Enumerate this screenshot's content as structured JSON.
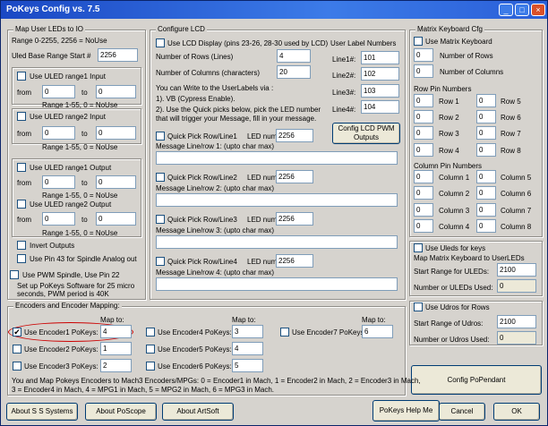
{
  "window": {
    "title": "PoKeys Config vs.  7.5",
    "minimize": "_",
    "maximize": "□",
    "close": "×"
  },
  "uled": {
    "group": "Map User LEDs to IO",
    "range_note": "Range 0-2255, 2256 = NoUse",
    "base_label": "Uled Base Range Start #",
    "base_value": "2256",
    "in1": {
      "label": "Use ULED range1 Input",
      "from_label": "from",
      "to_label": "to",
      "from": "0",
      "to": "0",
      "note": "Range 1-55, 0 = NoUse"
    },
    "in2": {
      "label": "Use ULED range2 Input",
      "from_label": "from",
      "to_label": "to",
      "from": "0",
      "to": "0",
      "note": "Range 1-55, 0 = NoUse"
    },
    "out1": {
      "label": "Use ULED range1 Output",
      "from_label": "from",
      "to_label": "to",
      "from": "0",
      "to": "0",
      "note": "Range 1-55, 0 = NoUse"
    },
    "out2": {
      "label": "Use ULED range2 Output",
      "from_label": "from",
      "to_label": "to",
      "from": "0",
      "to": "0",
      "note": "Range 1-55, 0 = NoUse"
    },
    "invert": "Invert Outputs",
    "pin43": "Use Pin 43 for Spindle Analog out",
    "pwm": "Use PWM Spindle, Use Pin 22",
    "pwm_note1": "Set up PoKeys Software for 25 micro",
    "pwm_note2": "seconds, PWM period is 40K"
  },
  "lcd": {
    "group": "Configure LCD",
    "use_label": "Use LCD Display (pins 23-26, 28-30 used by LCD)",
    "rows_label": "Number of Rows (Lines)",
    "rows": "4",
    "cols_label": "Number of Columns (characters)",
    "cols": "20",
    "help1": "You can Write to the UserLabels via :",
    "help2": "1). VB (Cypress Enable).",
    "help3": "2). Use the Quick picks below, pick the  LED number",
    "help4": "that will trigger your Message, fill in your message.",
    "user_labels": "User Label Numbers",
    "line_labels": [
      "Line1#:",
      "Line2#:",
      "Line3#:",
      "Line4#:"
    ],
    "line_values": [
      "101",
      "102",
      "103",
      "104"
    ],
    "pwm_btn": "Config LCD PWM Outputs",
    "qp": [
      {
        "label": "Quick Pick Row/Line1",
        "led_label": "LED num",
        "led": "2256",
        "msg": "Message Line/row 1: (upto char max)"
      },
      {
        "label": "Quick Pick Row/Line2",
        "led_label": "LED num",
        "led": "2256",
        "msg": "Message Line/row 2: (upto char max)"
      },
      {
        "label": "Quick Pick Row/Line3",
        "led_label": "LED num",
        "led": "2256",
        "msg": "Message Line/row 3: (upto char max)"
      },
      {
        "label": "Quick Pick Row/Line4",
        "led_label": "LED num",
        "led": "2256",
        "msg": "Message Line/row 4: (upto char max)"
      }
    ]
  },
  "matrix": {
    "group": "Matrix Keyboard Cfg",
    "use_label": "Use Matrix Keyboard",
    "rows_label": "Number of Rows",
    "rows": "0",
    "cols_label": "Number of Columns",
    "cols": "0",
    "row_pins_title": "Row Pin Numbers",
    "row_labels": [
      "Row 1",
      "Row 2",
      "Row 3",
      "Row 4",
      "Row 5",
      "Row 6",
      "Row 7",
      "Row 8"
    ],
    "row_values": [
      "0",
      "0",
      "0",
      "0",
      "0",
      "0",
      "0",
      "0"
    ],
    "col_pins_title": "Column Pin Numbers",
    "col_labels": [
      "Column 1",
      "Column 2",
      "Column 3",
      "Column 4",
      "Column 5",
      "Column 6",
      "Column 7",
      "Column 8"
    ],
    "col_values": [
      "0",
      "0",
      "0",
      "0",
      "0",
      "0",
      "0",
      "0"
    ]
  },
  "uleds_keys": {
    "label": "Use Uleds for keys",
    "note": "Map Matrix Keyboard to UserLEDs",
    "start_label": "Start Range for ULEDs:",
    "start": "2100",
    "num_label": "Number or ULEDs Used:",
    "num": "0"
  },
  "udros": {
    "label": "Use Udros for Rows",
    "start_label": "Start Range of Udros:",
    "start": "2100",
    "num_label": "Number or Udros Used:",
    "num": "0"
  },
  "pendant_btn": "Config PoPendant",
  "enc": {
    "group": "Encoders and Encoder Mapping:",
    "map_to": "Map to:",
    "items": [
      {
        "label": "Use Encoder1 PoKeys:",
        "value": "4",
        "checked": "✔"
      },
      {
        "label": "Use Encoder2 PoKeys:",
        "value": "1",
        "checked": ""
      },
      {
        "label": "Use Encoder3 PoKeys:",
        "value": "2",
        "checked": ""
      },
      {
        "label": "Use Encoder4 PoKeys:",
        "value": "3",
        "checked": ""
      },
      {
        "label": "Use Encoder5 PoKeys:",
        "value": "4",
        "checked": ""
      },
      {
        "label": "Use Encoder6 PoKeys:",
        "value": "5",
        "checked": ""
      },
      {
        "label": "Use Encoder7 PoKeys:",
        "value": "6",
        "checked": ""
      }
    ],
    "note1": "You and Map Pokeys Encoders to Mach3 Encoders/MPGs: 0 = Encoder1 in Mach, 1 = Encoder2 in Mach, 2 = Encoder3 in Mach,",
    "note2": "3 = Encoder4 in Mach, 4 = MPG1 in Mach, 5 = MPG2 in Mach, 6 = MPG3 in Mach."
  },
  "footer": {
    "about_ss": "About S S Systems",
    "about_poscope": "About PoScope",
    "about_artsoft": "About ArtSoft",
    "help": "PoKeys Help Me",
    "cancel": "Cancel",
    "ok": "OK"
  }
}
